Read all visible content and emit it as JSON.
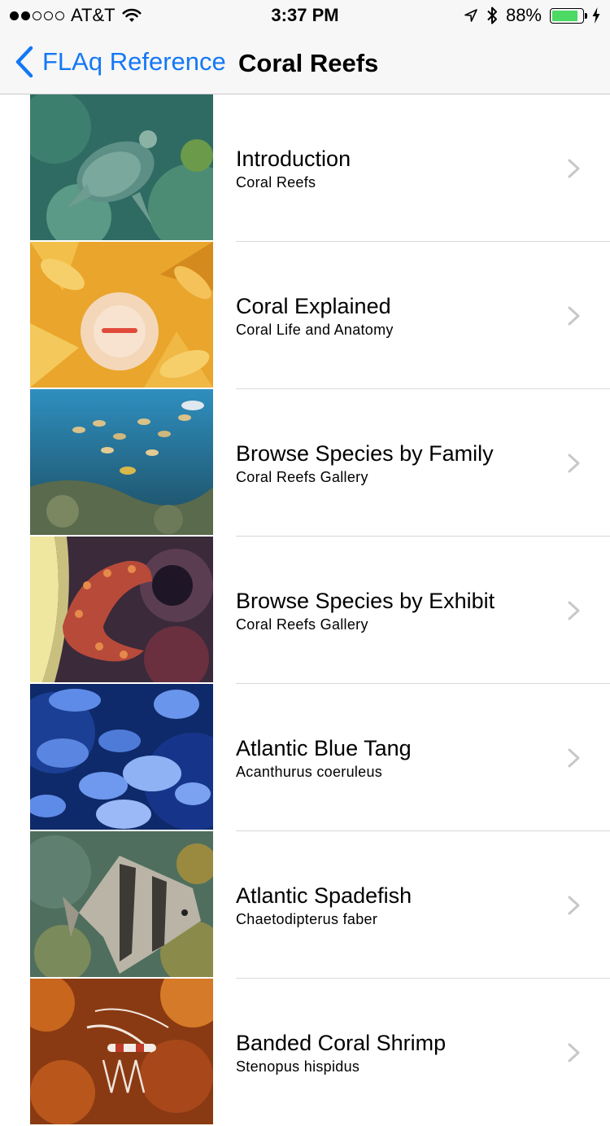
{
  "status_bar": {
    "carrier": "AT&T",
    "signal_bars_filled": 2,
    "signal_bars_total": 5,
    "time": "3:37 PM",
    "battery_percent": "88%",
    "battery_level": 0.88,
    "icons": [
      "wifi-icon",
      "location-arrow-icon",
      "bluetooth-icon",
      "battery-icon",
      "charging-bolt-icon"
    ]
  },
  "nav": {
    "back_label": "FLAq Reference",
    "title": "Coral Reefs",
    "accent_color": "#1478f5"
  },
  "rows": [
    {
      "title": "Introduction",
      "subtitle": "Coral Reefs",
      "thumbnail": "sea-turtle-photo"
    },
    {
      "title": "Coral Explained",
      "subtitle": "Coral Life and Anatomy",
      "thumbnail": "coral-polyp-photo"
    },
    {
      "title": "Browse Species by Family",
      "subtitle": "Coral Reefs Gallery",
      "thumbnail": "reef-fish-school-photo"
    },
    {
      "title": "Browse Species by Exhibit",
      "subtitle": "Coral Reefs Gallery",
      "thumbnail": "sea-cucumber-photo"
    },
    {
      "title": "Atlantic Blue Tang",
      "subtitle": "Acanthurus coeruleus",
      "thumbnail": "blue-tang-photo"
    },
    {
      "title": "Atlantic Spadefish",
      "subtitle": "Chaetodipterus faber",
      "thumbnail": "spadefish-photo"
    },
    {
      "title": "Banded Coral Shrimp",
      "subtitle": "Stenopus hispidus",
      "thumbnail": "coral-shrimp-photo"
    }
  ]
}
